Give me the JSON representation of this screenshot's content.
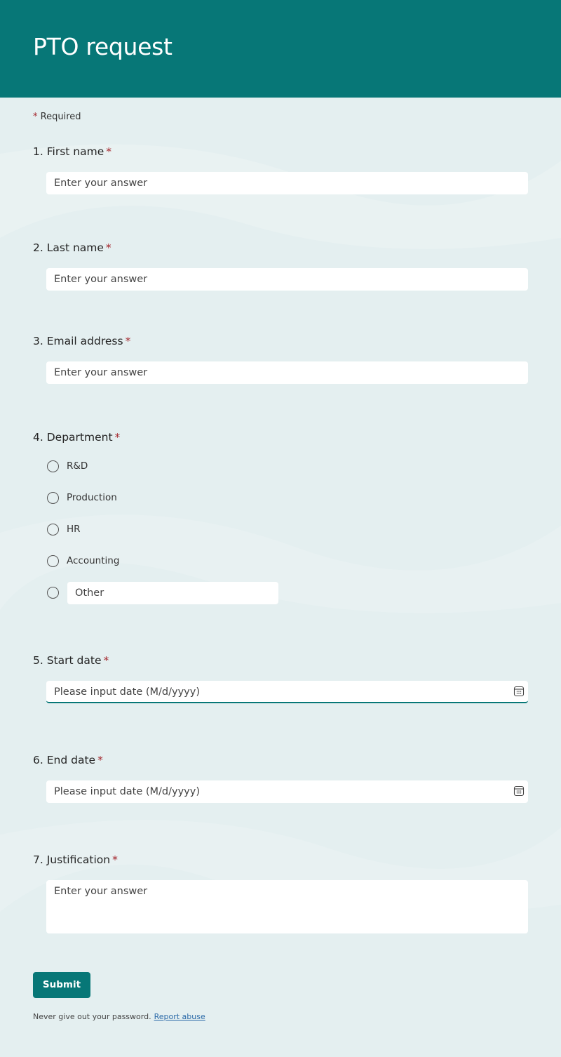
{
  "header": {
    "title": "PTO request"
  },
  "required_note": {
    "star": "*",
    "label": "Required"
  },
  "questions": [
    {
      "number": "1.",
      "label": "First name",
      "required": "*",
      "placeholder": "Enter your answer"
    },
    {
      "number": "2.",
      "label": "Last name",
      "required": "*",
      "placeholder": "Enter your answer"
    },
    {
      "number": "3.",
      "label": "Email address",
      "required": "*",
      "placeholder": "Enter your answer"
    },
    {
      "number": "4.",
      "label": "Department",
      "required": "*",
      "options": [
        "R&D",
        "Production",
        "HR",
        "Accounting"
      ],
      "other_placeholder": "Other"
    },
    {
      "number": "5.",
      "label": "Start date",
      "required": "*",
      "placeholder": "Please input date (M/d/yyyy)",
      "icon": "calendar-icon"
    },
    {
      "number": "6.",
      "label": "End date",
      "required": "*",
      "placeholder": "Please input date (M/d/yyyy)",
      "icon": "calendar-icon"
    },
    {
      "number": "7.",
      "label": "Justification",
      "required": "*",
      "placeholder": "Enter your answer"
    }
  ],
  "submit": {
    "label": "Submit"
  },
  "footer": {
    "text": "Never give out your password.",
    "link": "Report abuse"
  },
  "colors": {
    "brand": "#077777",
    "required": "#a4262c",
    "background": "#e4eff0"
  }
}
